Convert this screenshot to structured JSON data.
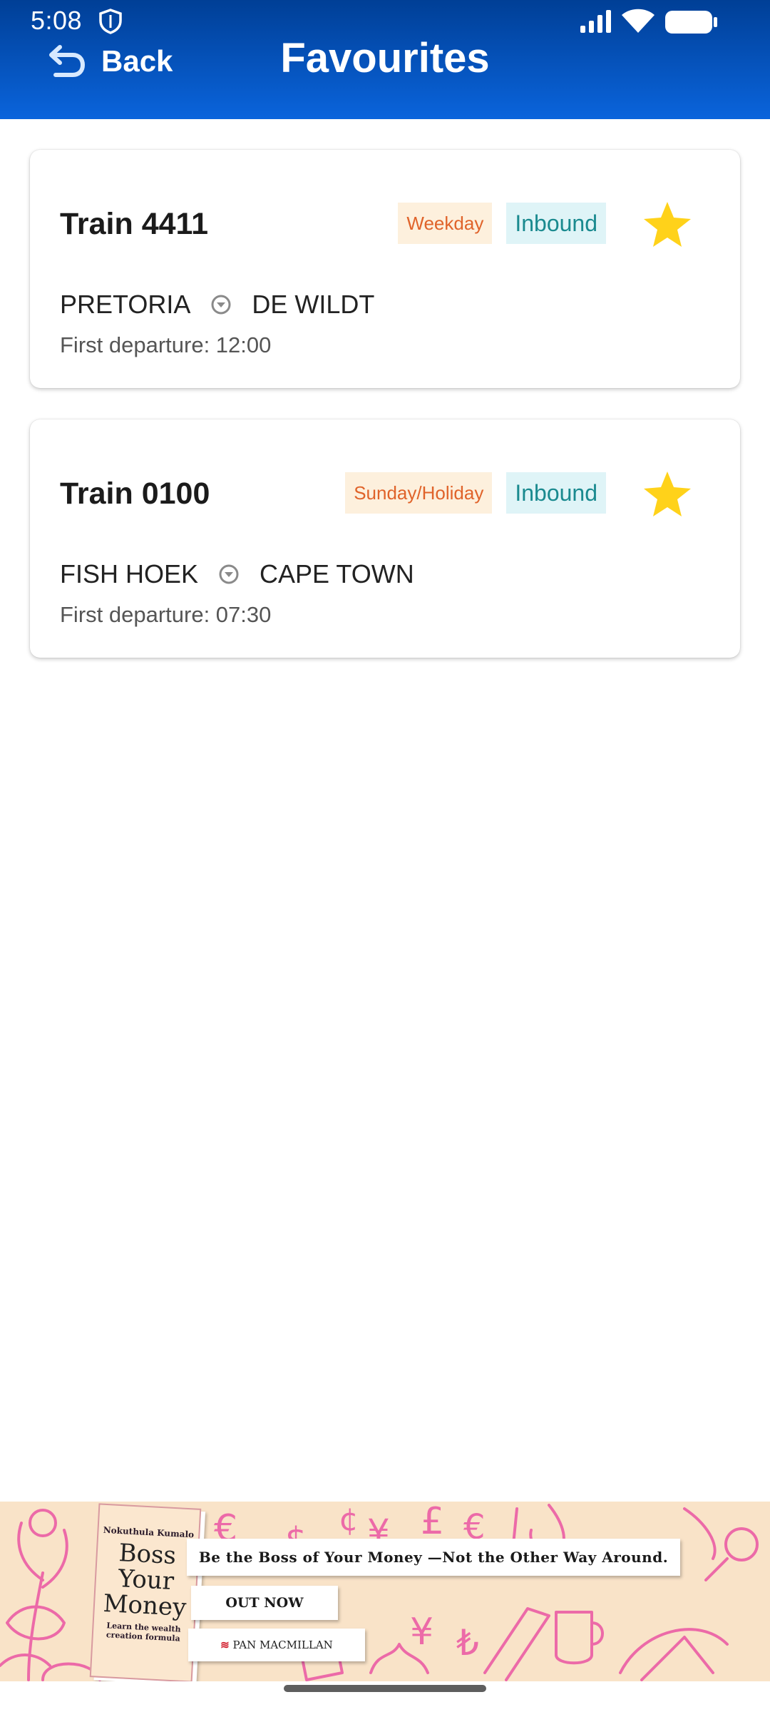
{
  "status_bar": {
    "time": "5:08",
    "icons": [
      "shield-icon",
      "signal-icon",
      "wifi-icon",
      "battery-icon"
    ]
  },
  "header": {
    "back_label": "Back",
    "title": "Favourites",
    "gradient_colors": [
      "#003f96",
      "#0a64dc"
    ]
  },
  "favourites": [
    {
      "train": "Train 4411",
      "day_badge": "Weekday",
      "direction_badge": "Inbound",
      "from": "PRETORIA",
      "to": "DE WILDT",
      "first_departure": "First departure: 12:00",
      "favourited": true
    },
    {
      "train": "Train 0100",
      "day_badge": "Sunday/Holiday",
      "direction_badge": "Inbound",
      "from": "FISH HOEK",
      "to": "CAPE TOWN",
      "first_departure": "First departure: 07:30",
      "favourited": true
    }
  ],
  "ad": {
    "book_author": "Nokuthula Kumalo",
    "book_title_lines": [
      "Boss",
      "Your",
      "Money"
    ],
    "book_subtitle": "Learn the wealth creation formula",
    "tagline": "Be the Boss of Your Money —Not the Other Way Around.",
    "cta": "OUT NOW",
    "publisher": "PAN MACMILLAN"
  },
  "colors": {
    "day_badge_bg": "#fdf0dd",
    "day_badge_text": "#e0632a",
    "direction_badge_bg": "#dff4f7",
    "direction_badge_text": "#1a8a8f",
    "star": "#ffd21a",
    "ad_background": "#f9e3c8",
    "ad_doodle": "#ec6aa8"
  }
}
